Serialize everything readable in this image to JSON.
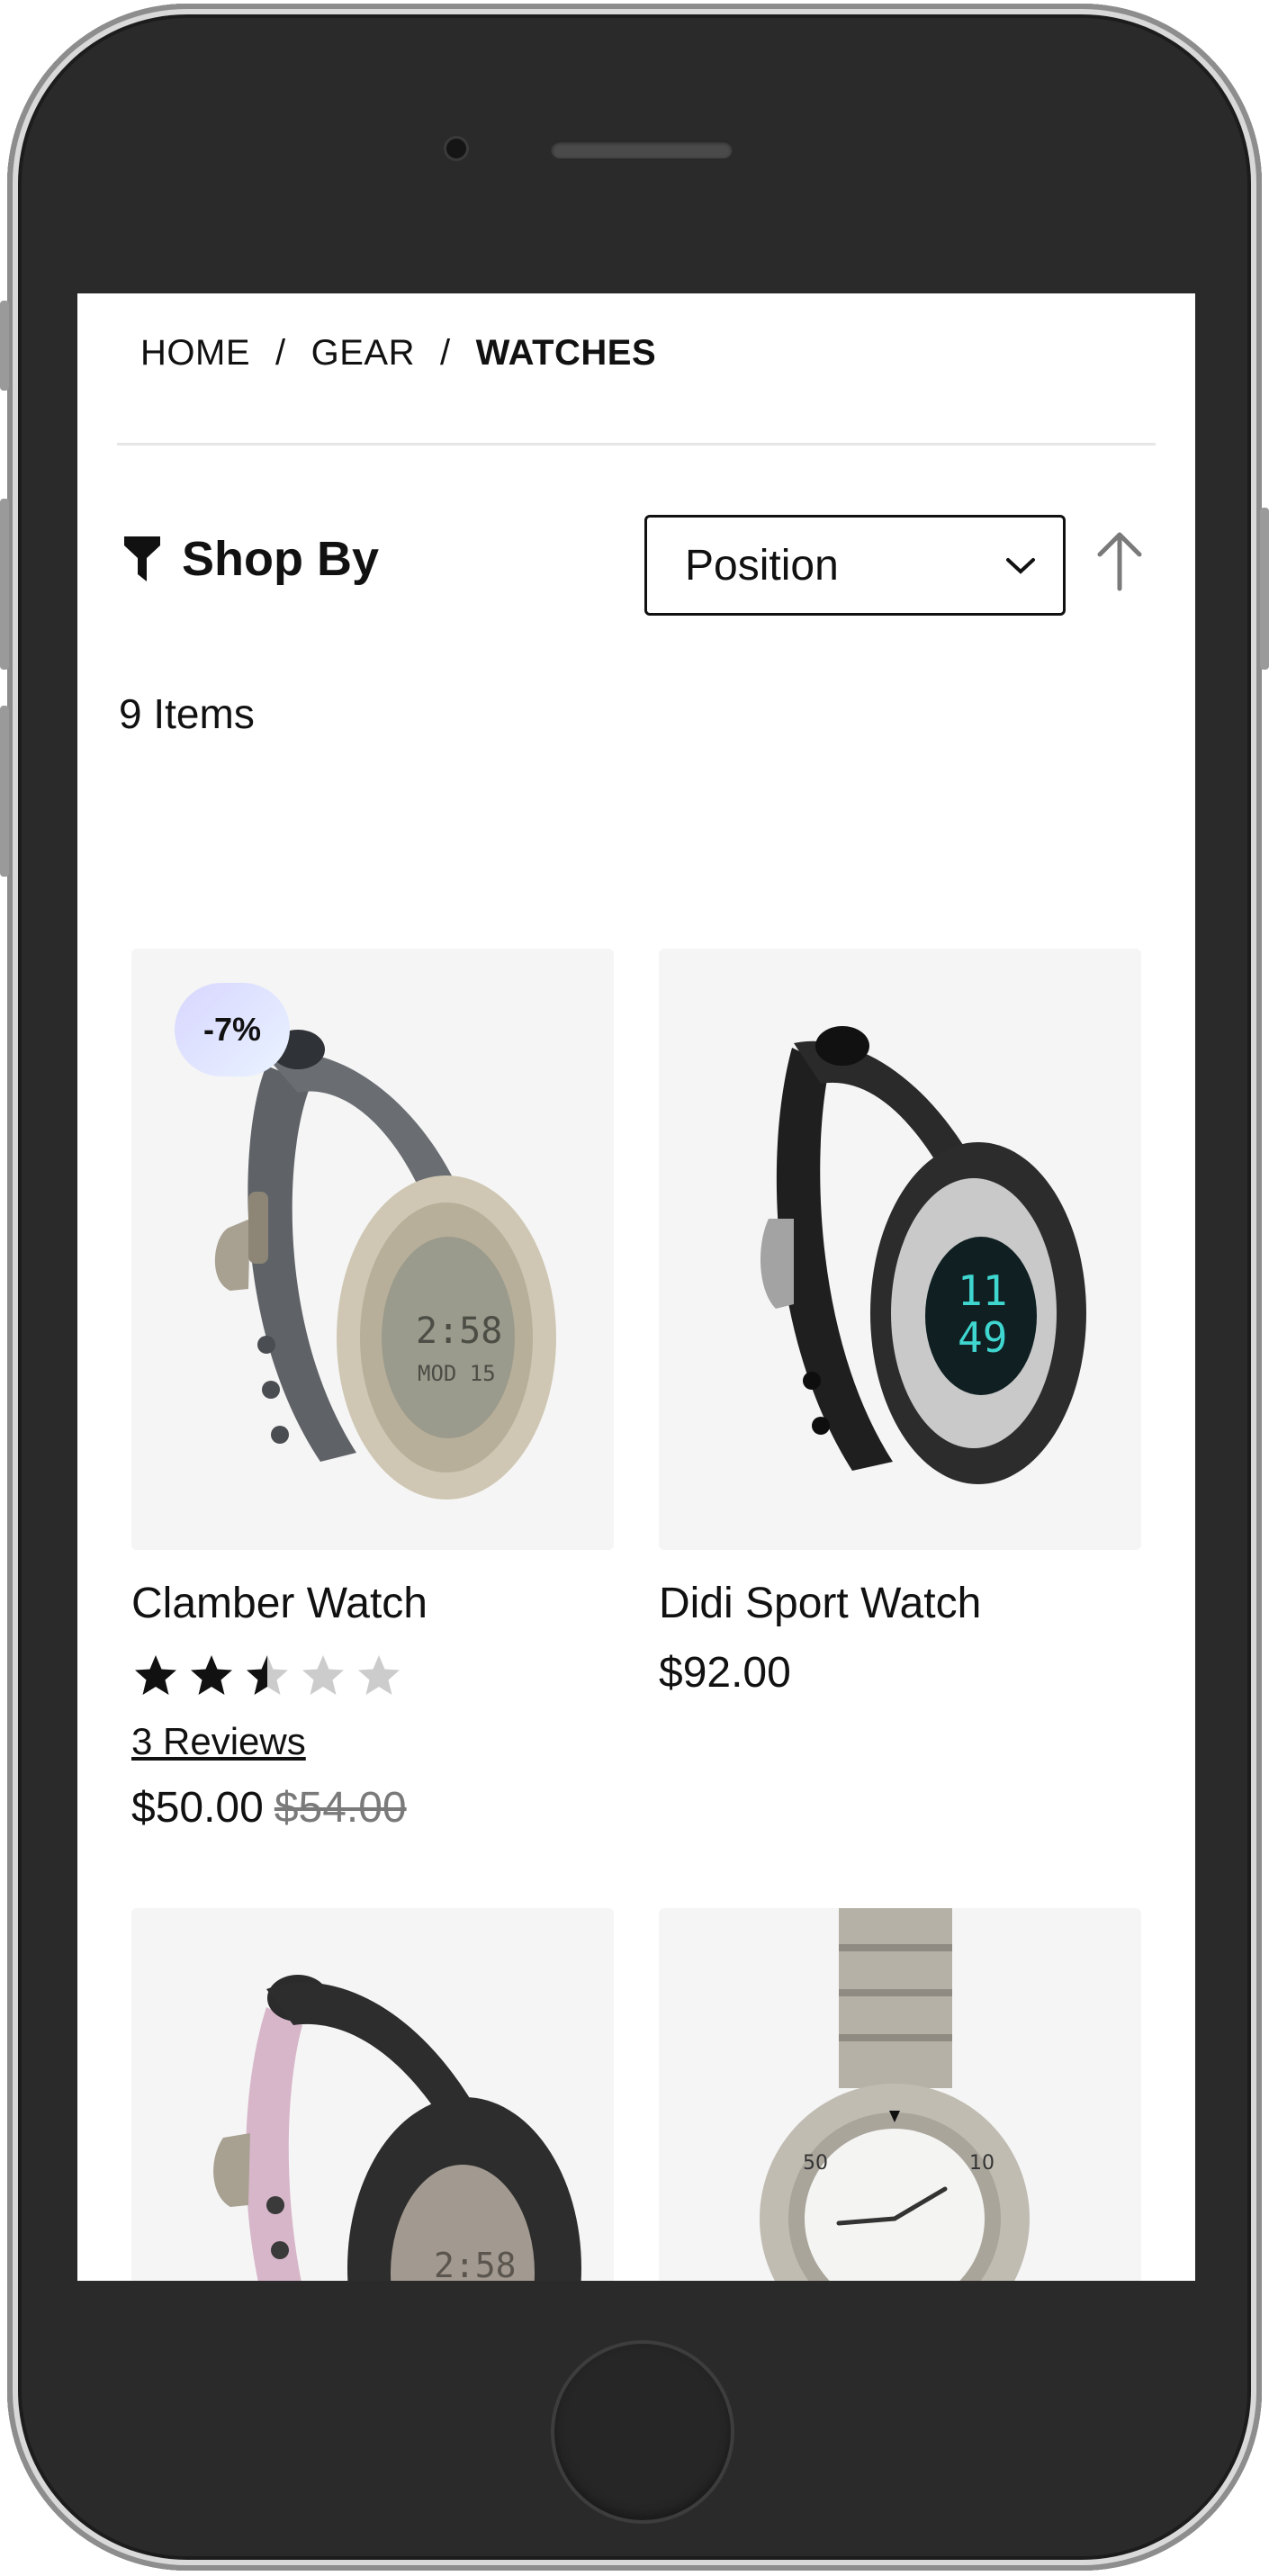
{
  "breadcrumb": {
    "home": "HOME",
    "sep": "/",
    "gear": "GEAR",
    "current": "WATCHES"
  },
  "toolbar": {
    "shop_by": "Shop By",
    "sort_value": "Position",
    "item_count": "9 Items"
  },
  "products": [
    {
      "name": "Clamber Watch",
      "price": "$50.00",
      "old_price": "$54.00",
      "discount": "-7%",
      "rating_stars": 2.5,
      "reviews": "3  Reviews"
    },
    {
      "name": "Didi Sport Watch",
      "price": "$92.00"
    }
  ],
  "colors": {
    "text": "#111111",
    "card_bg": "#f5f5f5",
    "strike": "#7a7a7a",
    "star_on": "#111111",
    "star_off": "#cccccc"
  },
  "icons": [
    "filter-icon",
    "chevron-down-icon",
    "arrow-up-icon",
    "star-icon"
  ]
}
